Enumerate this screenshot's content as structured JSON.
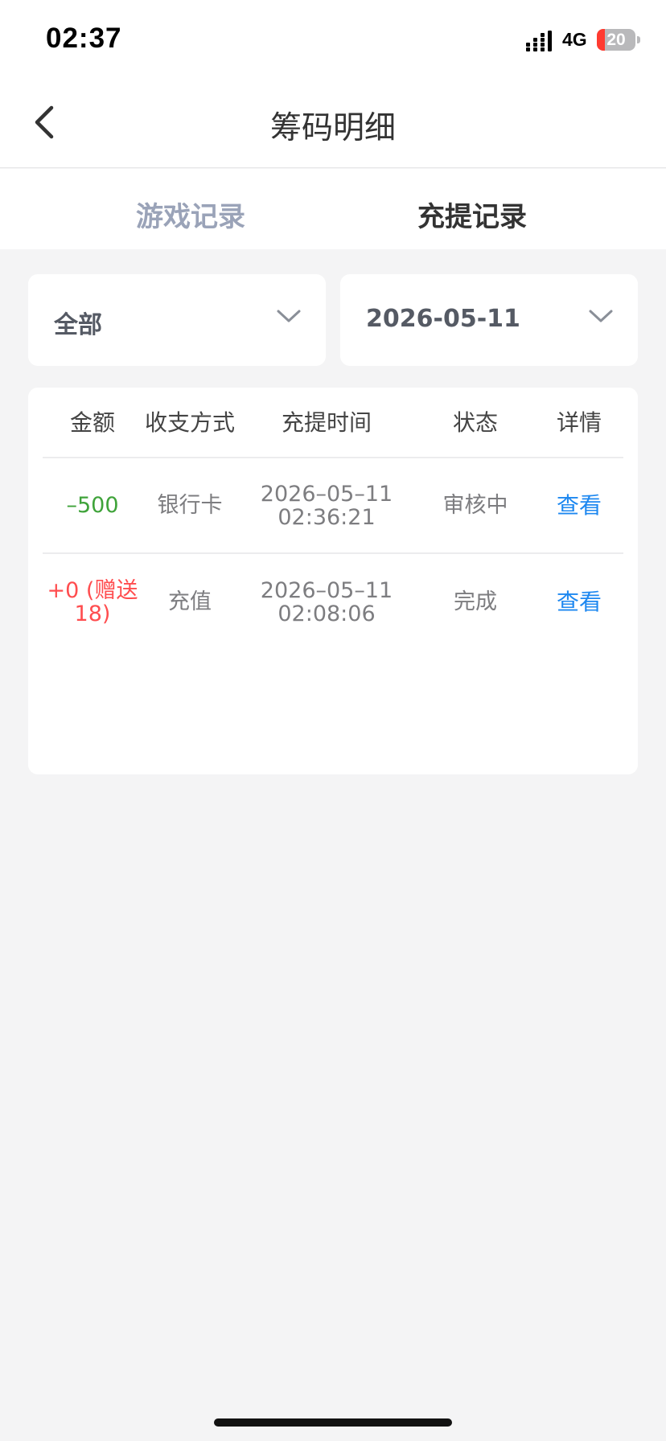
{
  "status_bar": {
    "time": "02:37",
    "network": "4G",
    "battery_level": "20",
    "battery_fraction": 0.2
  },
  "nav": {
    "title": "筹码明细",
    "back_icon": "chevron-left-icon"
  },
  "tabs": [
    {
      "label": "游戏记录",
      "active": false
    },
    {
      "label": "充提记录",
      "active": true
    }
  ],
  "filters": {
    "type": {
      "value": "全部",
      "icon": "chevron-down-icon"
    },
    "date": {
      "value": "2026-05-11",
      "icon": "chevron-down-icon"
    }
  },
  "table": {
    "columns": [
      "金额",
      "收支方式",
      "充提时间",
      "状态",
      "详情"
    ],
    "rows": [
      {
        "amount": "–500",
        "method": "银行卡",
        "date": "2026–05–11",
        "time": "02:36:21",
        "status": "审核中",
        "detail": "查看",
        "amount_color": "#3fa33a"
      },
      {
        "amount_line1": "+0 (赠送",
        "amount_line2": "18)",
        "method": "充值",
        "date": "2026–05–11",
        "time": "02:08:06",
        "status": "完成",
        "detail": "查看",
        "amount_color": "#ff4d4f"
      }
    ]
  },
  "colors": {
    "accent_link": "#1e88f0",
    "negative": "#3fa33a",
    "positive": "#ff4d4f",
    "inactive_tab": "#9aa3b8"
  }
}
